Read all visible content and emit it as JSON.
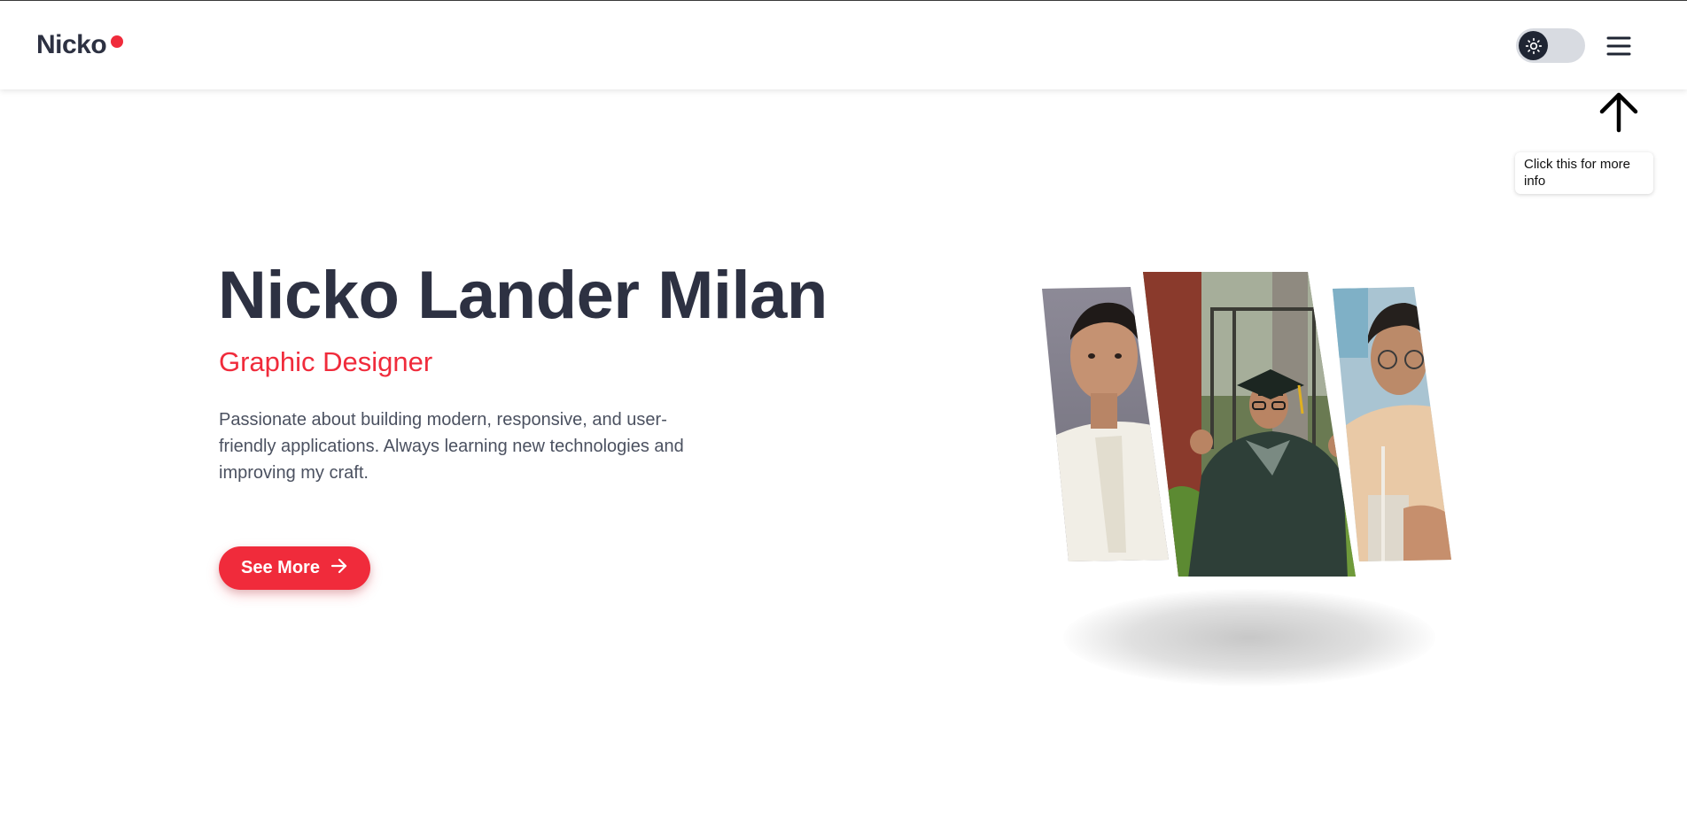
{
  "header": {
    "logo_text": "Nicko",
    "logo_dot_color": "#f02b3b",
    "theme_toggle_icon": "sun-icon",
    "menu_icon": "hamburger-menu-icon"
  },
  "hint": {
    "arrow_icon": "arrow-up-icon",
    "tooltip_text": "Click this for more info"
  },
  "hero": {
    "name": "Nicko Lander Milan",
    "role": "Graphic Designer",
    "description": "Passionate about building modern, responsive, and user-friendly applications. Always learning new technologies and improving my craft.",
    "cta_label": "See More",
    "cta_icon": "arrow-right-icon"
  },
  "collage": {
    "photos": [
      {
        "label": "portrait photo",
        "icon": "portrait-photo"
      },
      {
        "label": "graduation photo",
        "icon": "graduation-photo"
      },
      {
        "label": "candid photo",
        "icon": "candid-photo"
      }
    ]
  },
  "colors": {
    "accent": "#f02b3b",
    "heading": "#2d3142",
    "body_text": "#4b5160"
  }
}
